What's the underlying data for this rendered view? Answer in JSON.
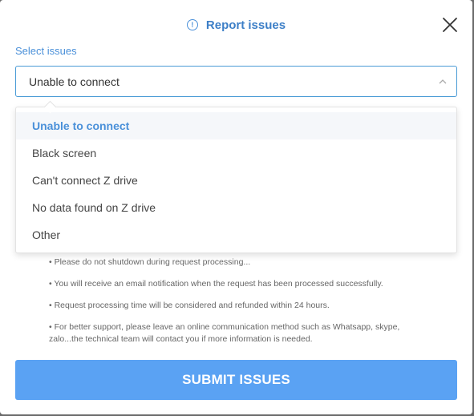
{
  "header": {
    "title": "Report issues",
    "icon": "info-circle-icon",
    "accent_color": "#3d7fc7"
  },
  "select": {
    "label": "Select issues",
    "current_value": "Unable to connect",
    "options": [
      "Unable to connect",
      "Black screen",
      "Can't connect Z drive",
      "No data found on Z drive",
      "Other"
    ]
  },
  "notes": [
    "• Please do not shutdown during request processing...",
    "• You will receive an email notification when the request has been processed successfully.",
    "• Request processing time will be considered and refunded within 24 hours.",
    "• For better support, please leave an online communication method such as Whatsapp, skype, zalo...the technical team will contact you if more information is needed."
  ],
  "submit": {
    "label": "SUBMIT ISSUES",
    "color": "#5aa2f3"
  }
}
